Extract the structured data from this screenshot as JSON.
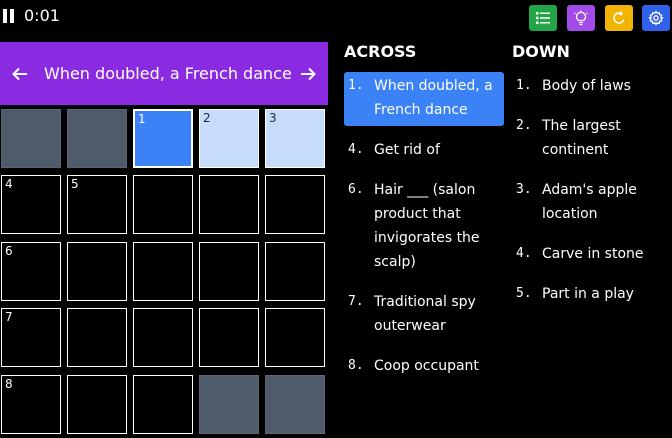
{
  "toolbar": {
    "timer": "0:01",
    "buttons": [
      {
        "name": "list-button",
        "icon": "list-icon",
        "color": "#22a447"
      },
      {
        "name": "hint-button",
        "icon": "lightbulb-icon",
        "color": "#a24be8"
      },
      {
        "name": "reset-button",
        "icon": "refresh-icon",
        "color": "#f1b400"
      },
      {
        "name": "settings-button",
        "icon": "gear-icon",
        "color": "#2f62e8"
      }
    ]
  },
  "banner": {
    "clue": "When doubled, a French dance",
    "color": "#8a2be2",
    "prev_icon": "arrow-left-icon",
    "next_icon": "arrow-right-icon"
  },
  "grid": {
    "colors": {
      "selected": "#3b82f6",
      "word": "#c7dcfb",
      "block": "#4f5b6a"
    },
    "numbers": {
      "c1": "1",
      "c2": "2",
      "c3": "3",
      "c4": "4",
      "c5": "5",
      "c6": "6",
      "c7": "7",
      "c8": "8"
    }
  },
  "across": {
    "title": "ACROSS",
    "clues": [
      {
        "num": "1.",
        "text": "When doubled, a French dance"
      },
      {
        "num": "4.",
        "text": "Get rid of"
      },
      {
        "num": "6.",
        "text": "Hair ___ (salon product that invigorates the scalp)"
      },
      {
        "num": "7.",
        "text": "Traditional spy outerwear"
      },
      {
        "num": "8.",
        "text": "Coop occupant"
      }
    ]
  },
  "down": {
    "title": "DOWN",
    "clues": [
      {
        "num": "1.",
        "text": "Body of laws"
      },
      {
        "num": "2.",
        "text": "The largest continent"
      },
      {
        "num": "3.",
        "text": "Adam's apple location"
      },
      {
        "num": "4.",
        "text": "Carve in stone"
      },
      {
        "num": "5.",
        "text": "Part in a play"
      }
    ]
  }
}
